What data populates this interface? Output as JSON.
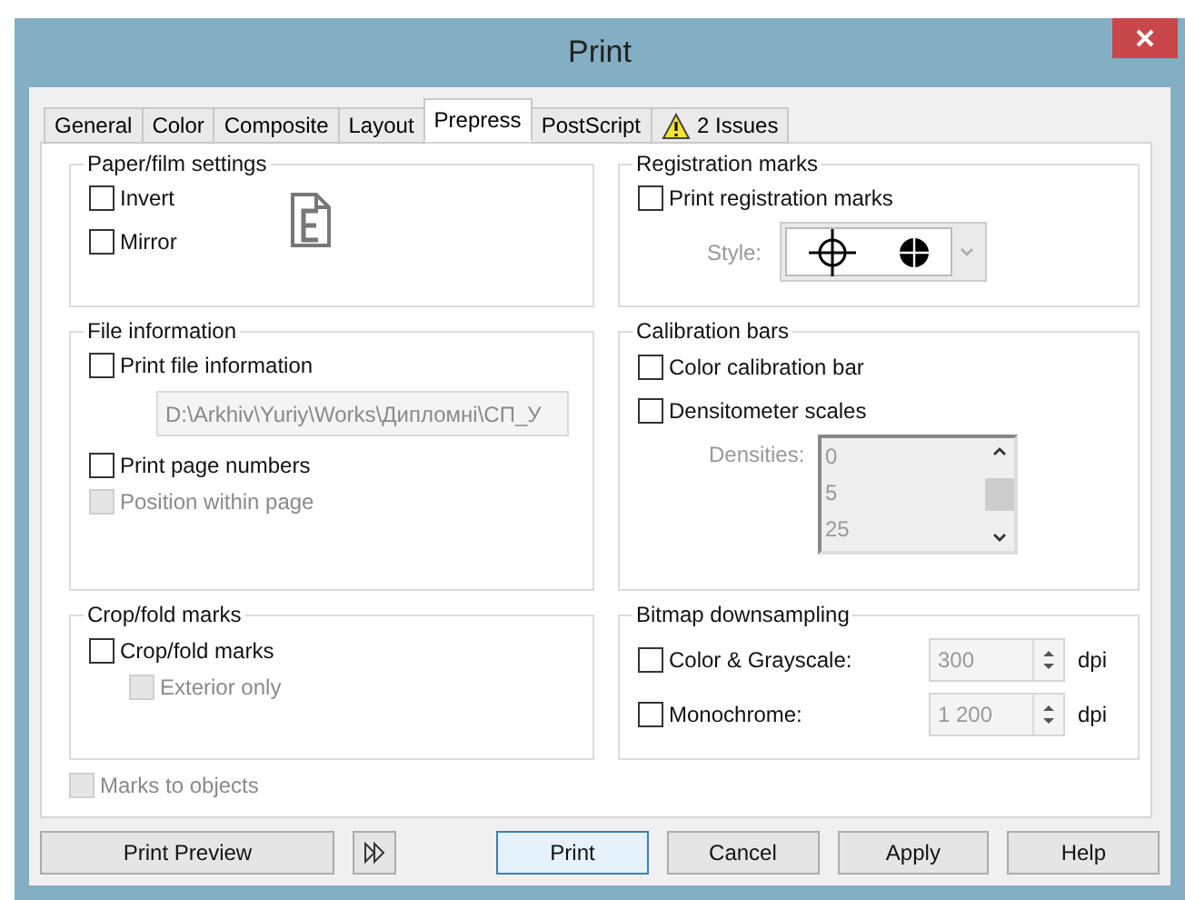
{
  "window": {
    "title": "Print"
  },
  "tabs": [
    {
      "label": "General",
      "selected": false,
      "kind": "plain"
    },
    {
      "label": "Color",
      "selected": false,
      "kind": "plain"
    },
    {
      "label": "Composite",
      "selected": false,
      "kind": "plain"
    },
    {
      "label": "Layout",
      "selected": false,
      "kind": "plain"
    },
    {
      "label": "Prepress",
      "selected": true,
      "kind": "plain"
    },
    {
      "label": "PostScript",
      "selected": false,
      "kind": "plain"
    },
    {
      "label": "2 Issues",
      "selected": false,
      "kind": "warning"
    }
  ],
  "paper_film_settings": {
    "title": "Paper/film settings",
    "options": [
      {
        "label": "Invert",
        "checked": false,
        "disabled": false
      },
      {
        "label": "Mirror",
        "checked": false,
        "disabled": false
      }
    ]
  },
  "file_information": {
    "title": "File information",
    "print_file_information": {
      "label": "Print file information",
      "checked": false,
      "disabled": false
    },
    "file_path": {
      "value": "D:\\Arkhiv\\Yuriy\\Works\\Дипломні\\СП_У",
      "disabled": true
    },
    "print_page_numbers": {
      "label": "Print page numbers",
      "checked": false,
      "disabled": false
    },
    "position_within_page": {
      "label": "Position within page",
      "checked": false,
      "disabled": true
    }
  },
  "crop_fold_marks": {
    "title": "Crop/fold marks",
    "crop_fold_marks": {
      "label": "Crop/fold marks",
      "checked": false,
      "disabled": false
    },
    "exterior_only": {
      "label": "Exterior only",
      "checked": false,
      "disabled": true
    }
  },
  "marks_to_objects": {
    "label": "Marks to objects",
    "checked": false,
    "disabled": true
  },
  "registration_marks": {
    "title": "Registration marks",
    "print_registration_marks": {
      "label": "Print registration marks",
      "checked": false,
      "disabled": false
    },
    "style": {
      "label": "Style:",
      "disabled": true
    }
  },
  "calibration_bars": {
    "title": "Calibration bars",
    "color_calibration_bar": {
      "label": "Color calibration bar",
      "checked": false,
      "disabled": false
    },
    "densitometer_scales": {
      "label": "Densitometer scales",
      "checked": false,
      "disabled": false
    },
    "densities": {
      "label": "Densities:",
      "disabled": true,
      "items": [
        "0",
        "5",
        "25"
      ]
    }
  },
  "bitmap_downsampling": {
    "title": "Bitmap downsampling",
    "rows": [
      {
        "label": "Color & Grayscale:",
        "checked": false,
        "disabled": false,
        "value": "300",
        "unit": "dpi"
      },
      {
        "label": "Monochrome:",
        "checked": false,
        "disabled": false,
        "value": "1 200",
        "unit": "dpi"
      }
    ]
  },
  "buttons": [
    {
      "label": "Print Preview",
      "kind": "preview"
    },
    {
      "label": "Print",
      "kind": "default"
    },
    {
      "label": "Cancel",
      "kind": "normal"
    },
    {
      "label": "Apply",
      "kind": "normal"
    },
    {
      "label": "Help",
      "kind": "normal"
    }
  ]
}
